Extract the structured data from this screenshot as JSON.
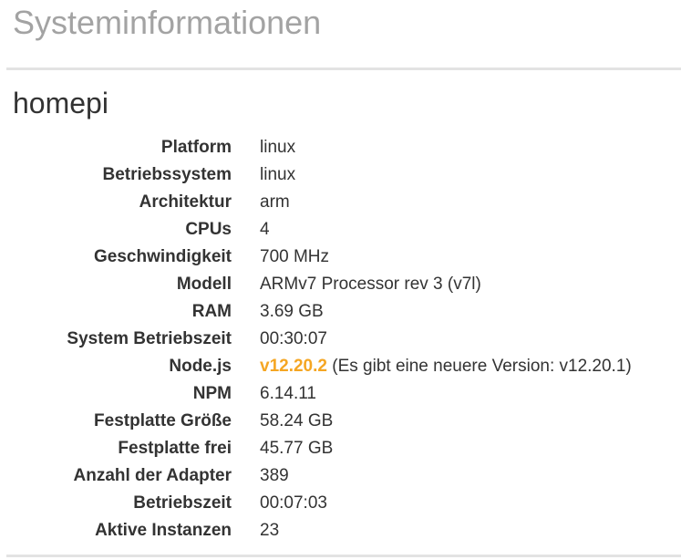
{
  "page": {
    "title": "Systeminformationen"
  },
  "host": {
    "name": "homepi"
  },
  "info": [
    {
      "label": "Platform",
      "value": "linux"
    },
    {
      "label": "Betriebssystem",
      "value": "linux"
    },
    {
      "label": "Architektur",
      "value": "arm"
    },
    {
      "label": "CPUs",
      "value": "4"
    },
    {
      "label": "Geschwindigkeit",
      "value": "700 MHz"
    },
    {
      "label": "Modell",
      "value": "ARMv7 Processor rev 3 (v7l)"
    },
    {
      "label": "RAM",
      "value": "3.69 GB"
    },
    {
      "label": "System Betriebszeit",
      "value": "00:30:07"
    },
    {
      "label": "Node.js",
      "version": "v12.20.2",
      "note": "(Es gibt eine neuere Version: v12.20.1)"
    },
    {
      "label": "NPM",
      "value": "6.14.11"
    },
    {
      "label": "Festplatte Größe",
      "value": "58.24 GB"
    },
    {
      "label": "Festplatte frei",
      "value": "45.77 GB"
    },
    {
      "label": "Anzahl der Adapter",
      "value": "389"
    },
    {
      "label": "Betriebszeit",
      "value": "00:07:03"
    },
    {
      "label": "Aktive Instanzen",
      "value": "23"
    }
  ],
  "colors": {
    "title": "#a3a3a3",
    "text": "#333333",
    "node_version_highlight": "#f5a623",
    "divider": "#e3e3e3"
  }
}
